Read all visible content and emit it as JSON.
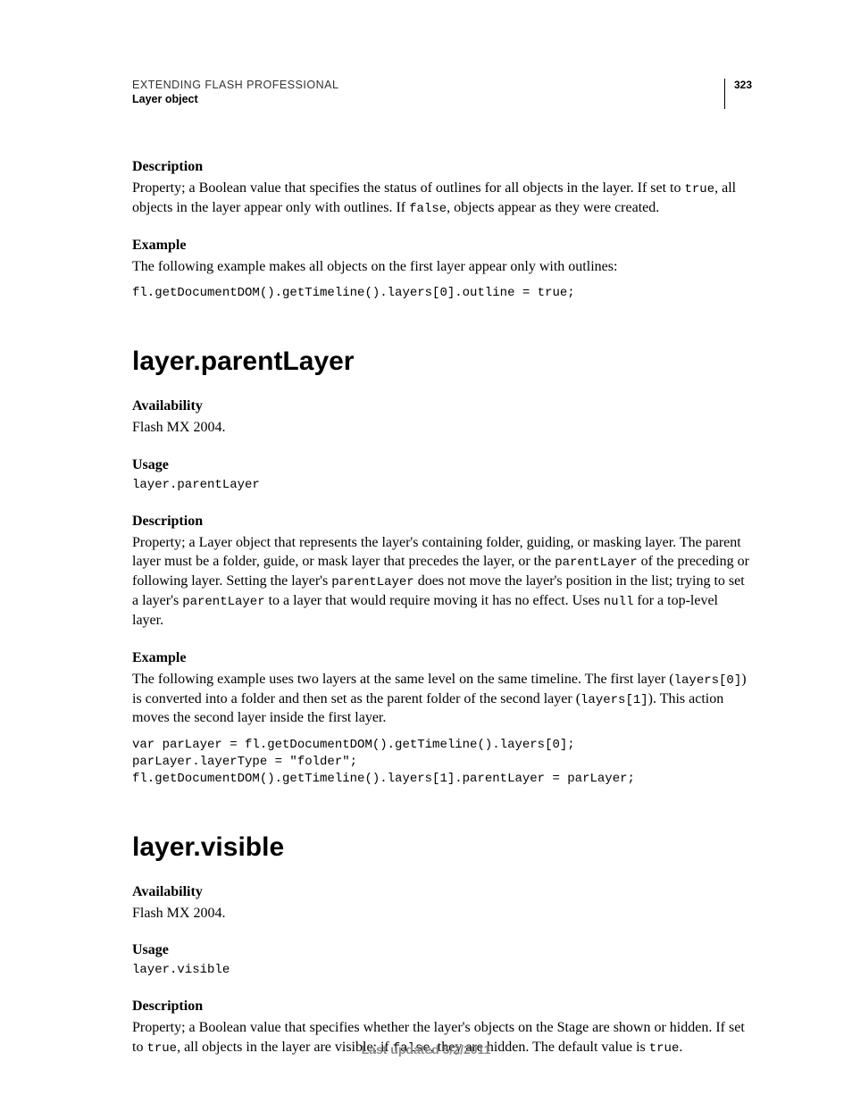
{
  "header": {
    "doc_title": "EXTENDING FLASH PROFESSIONAL",
    "chapter": "Layer object",
    "page_number": "323"
  },
  "section1": {
    "desc_heading": "Description",
    "desc_pre": "Property; a Boolean value that specifies the status of outlines for all objects in the layer. If set to ",
    "desc_code1": "true",
    "desc_mid": ", all objects in the layer appear only with outlines. If ",
    "desc_code2": "false",
    "desc_post": ", objects appear as they were created.",
    "example_heading": "Example",
    "example_intro": "The following example makes all objects on the first layer appear only with outlines:",
    "example_code": "fl.getDocumentDOM().getTimeline().layers[0].outline = true;"
  },
  "section2": {
    "title": "layer.parentLayer",
    "avail_heading": "Availability",
    "avail_text": "Flash MX 2004.",
    "usage_heading": "Usage",
    "usage_code": "layer.parentLayer",
    "desc_heading": "Description",
    "desc_p1_pre": "Property; a Layer object that represents the layer's containing folder, guiding, or masking layer. The parent layer must be a folder, guide, or mask layer that precedes the layer, or the ",
    "desc_p1_c1": "parentLayer",
    "desc_p1_mid1": " of the preceding or following layer. Setting the layer's ",
    "desc_p1_c2": "parentLayer",
    "desc_p1_mid2": " does not move the layer's position in the list; trying to set a layer's ",
    "desc_p1_c3": "parentLayer",
    "desc_p1_mid3": " to a layer that would require moving it has no effect. Uses ",
    "desc_p1_c4": "null",
    "desc_p1_post": " for a top-level layer.",
    "example_heading": "Example",
    "example_intro_pre": "The following example uses two layers at the same level on the same timeline. The first layer (",
    "example_intro_c1": "layers[0]",
    "example_intro_mid": ") is converted into a folder and then set as the parent folder of the second layer (",
    "example_intro_c2": "layers[1]",
    "example_intro_post": "). This action moves the second layer inside the first layer.",
    "example_code": "var parLayer = fl.getDocumentDOM().getTimeline().layers[0];\nparLayer.layerType = \"folder\";\nfl.getDocumentDOM().getTimeline().layers[1].parentLayer = parLayer;"
  },
  "section3": {
    "title": "layer.visible",
    "avail_heading": "Availability",
    "avail_text": "Flash MX 2004.",
    "usage_heading": "Usage",
    "usage_code": "layer.visible",
    "desc_heading": "Description",
    "desc_pre": "Property; a Boolean value that specifies whether the layer's objects on the Stage are shown or hidden. If set to ",
    "desc_c1": "true",
    "desc_mid1": ", all objects in the layer are visible; if ",
    "desc_c2": "false",
    "desc_mid2": ", they are hidden. The default value is ",
    "desc_c3": "true",
    "desc_post": "."
  },
  "footer": {
    "text": "Last updated 5/2/2011"
  }
}
